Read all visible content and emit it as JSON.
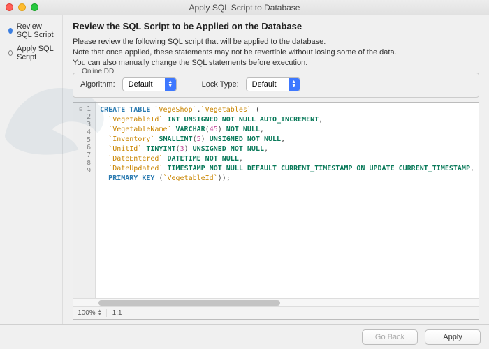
{
  "window": {
    "title": "Apply SQL Script to Database"
  },
  "sidebar": {
    "steps": [
      {
        "label": "Review SQL Script",
        "active": true
      },
      {
        "label": "Apply SQL Script",
        "active": false
      }
    ]
  },
  "main": {
    "heading": "Review the SQL Script to be Applied on the Database",
    "intro_line1": "Please review the following SQL script that will be applied to the database.",
    "intro_line2": "Note that once applied, these statements may not be revertible without losing some of the data.",
    "intro_line3": "You can also manually change the SQL statements before execution."
  },
  "ddl": {
    "legend": "Online DDL",
    "algorithm_label": "Algorithm:",
    "algorithm_value": "Default",
    "lock_label": "Lock Type:",
    "lock_value": "Default"
  },
  "editor": {
    "line_count": 9,
    "zoom": "100%",
    "ratio": "1:1",
    "sql": {
      "schema": "VegeShop",
      "table": "Vegetables",
      "columns": [
        {
          "name": "VegetableId",
          "type": "INT UNSIGNED NOT NULL AUTO_INCREMENT"
        },
        {
          "name": "VegetableName",
          "type": "VARCHAR",
          "len": 45,
          "mods": "NOT NULL"
        },
        {
          "name": "Inventory",
          "type": "SMALLINT",
          "len": 5,
          "mods": "UNSIGNED NOT NULL"
        },
        {
          "name": "UnitId",
          "type": "TINYINT",
          "len": 3,
          "mods": "UNSIGNED NOT NULL"
        },
        {
          "name": "DateEntered",
          "type": "DATETIME NOT NULL"
        },
        {
          "name": "DateUpdated",
          "type": "TIMESTAMP NOT NULL DEFAULT CURRENT_TIMESTAMP ON UPDATE CURRENT_TIMESTAMP"
        }
      ],
      "pk": "VegetableId"
    }
  },
  "footer": {
    "back": "Go Back",
    "apply": "Apply"
  }
}
